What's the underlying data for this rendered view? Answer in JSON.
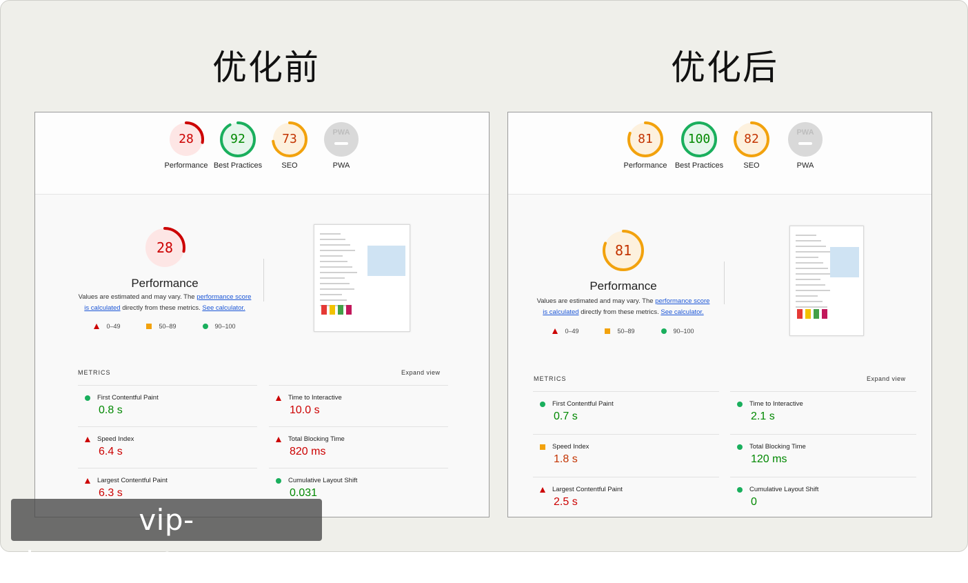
{
  "colors": {
    "fail": "#cc0000",
    "average": "#f2a20d",
    "pass": "#1aaf5d",
    "track_fail": "#fde6e5",
    "track_avg": "#fdf1de",
    "track_pass": "#e6f6ec",
    "pwa": "#d9d9d9"
  },
  "before": {
    "heading": "优化前",
    "gauges": [
      {
        "label": "Performance",
        "score": "28",
        "value": 0.28,
        "rating": "fail"
      },
      {
        "label": "Best Practices",
        "score": "92",
        "value": 0.92,
        "rating": "pass"
      },
      {
        "label": "SEO",
        "score": "73",
        "value": 0.73,
        "rating": "average"
      },
      {
        "label": "PWA",
        "score": "",
        "value": 0,
        "rating": "pwa",
        "logo_text": "PWA"
      }
    ],
    "perf": {
      "score": "28",
      "value": 0.28,
      "rating": "fail",
      "title": "Performance",
      "note_pre": "Values are estimated and may vary. The ",
      "note_link1": "performance score is calculated",
      "note_mid": " directly from these metrics. ",
      "note_link2": "See calculator.",
      "legend": [
        "0–49",
        "50–89",
        "90–100"
      ]
    },
    "metrics_header": "METRICS",
    "expand": "Expand view",
    "metrics": [
      {
        "name": "First Contentful Paint",
        "value": "0.8 s",
        "rating": "pass"
      },
      {
        "name": "Time to Interactive",
        "value": "10.0 s",
        "rating": "fail"
      },
      {
        "name": "Speed Index",
        "value": "6.4 s",
        "rating": "fail"
      },
      {
        "name": "Total Blocking Time",
        "value": "820 ms",
        "rating": "fail"
      },
      {
        "name": "Largest Contentful Paint",
        "value": "6.3 s",
        "rating": "fail"
      },
      {
        "name": "Cumulative Layout Shift",
        "value": "0.031",
        "rating": "pass"
      }
    ]
  },
  "after": {
    "heading": "优化后",
    "gauges": [
      {
        "label": "Performance",
        "score": "81",
        "value": 0.81,
        "rating": "average"
      },
      {
        "label": "Best Practices",
        "score": "100",
        "value": 1.0,
        "rating": "pass"
      },
      {
        "label": "SEO",
        "score": "82",
        "value": 0.82,
        "rating": "average"
      },
      {
        "label": "PWA",
        "score": "",
        "value": 0,
        "rating": "pwa",
        "logo_text": "PWA"
      }
    ],
    "perf": {
      "score": "81",
      "value": 0.81,
      "rating": "average",
      "title": "Performance",
      "note_pre": "Values are estimated and may vary. The ",
      "note_link1": "performance score is calculated",
      "note_mid": " directly from these metrics. ",
      "note_link2": "See calculator.",
      "legend": [
        "0–49",
        "50–89",
        "90–100"
      ]
    },
    "metrics_header": "METRICS",
    "expand": "Expand view",
    "metrics": [
      {
        "name": "First Contentful Paint",
        "value": "0.7 s",
        "rating": "pass"
      },
      {
        "name": "Time to Interactive",
        "value": "2.1 s",
        "rating": "pass"
      },
      {
        "name": "Speed Index",
        "value": "1.8 s",
        "rating": "average"
      },
      {
        "name": "Total Blocking Time",
        "value": "120 ms",
        "rating": "pass"
      },
      {
        "name": "Largest Contentful Paint",
        "value": "2.5 s",
        "rating": "fail"
      },
      {
        "name": "Cumulative Layout Shift",
        "value": "0",
        "rating": "pass"
      }
    ]
  },
  "watermark": "vip-boaosports.com.cn"
}
